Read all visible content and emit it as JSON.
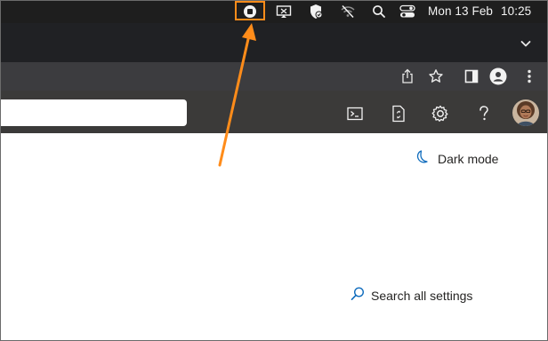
{
  "menubar": {
    "date": "Mon 13 Feb",
    "time": "10:25",
    "icons": [
      "screen-recording-stop-icon",
      "screen-mirroring-icon",
      "vpn-shield-icon",
      "wifi-off-icon",
      "spotlight-search-icon",
      "control-center-icon"
    ]
  },
  "tabstrip": {
    "overflow_icon": "chevron-down-icon"
  },
  "toolbar": {
    "icons": [
      "share-icon",
      "bookmark-star-icon",
      "sidebar-toggle-icon",
      "profile-icon",
      "more-menu-icon"
    ]
  },
  "portal": {
    "icons": [
      "cloud-shell-icon",
      "directory-switch-icon",
      "settings-gear-icon",
      "help-icon",
      "user-avatar"
    ]
  },
  "content": {
    "dark_mode_label": "Dark mode",
    "search_settings_label": "Search all settings"
  },
  "annotation": {
    "color": "#ff8c1a"
  }
}
